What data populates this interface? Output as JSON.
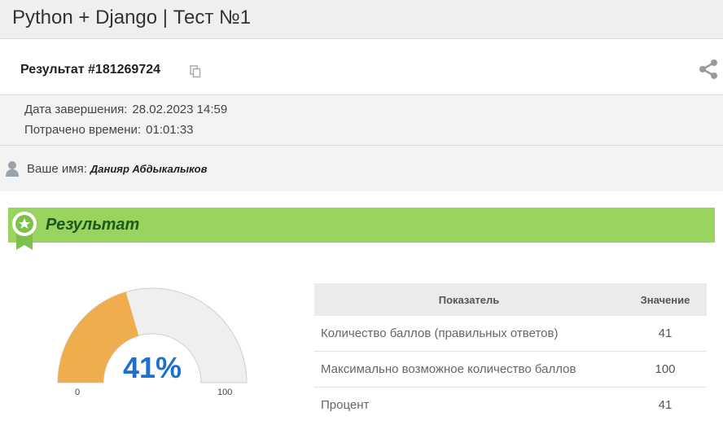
{
  "header": {
    "title": "Python + Django | Тест №1"
  },
  "result": {
    "title": "Результат #181269724",
    "copy_icon": "copy-icon",
    "share_icon": "share-icon"
  },
  "meta": {
    "finished_label": "Дата завершения:",
    "finished_value": "28.02.2023 14:59",
    "spent_label": "Потрачено времени:",
    "spent_value": "01:01:33"
  },
  "user": {
    "icon": "user-icon",
    "label": "Ваше имя:",
    "name": "Данияр Абдыкалыков"
  },
  "banner": {
    "label": "Результат",
    "icon": "award-ribbon-icon"
  },
  "gauge": {
    "value_text": "41%",
    "value": 41,
    "min_label": "0",
    "max_label": "100",
    "fill_color": "#f0ad4e",
    "track_color": "#efefef"
  },
  "table": {
    "headers": [
      "Показатель",
      "Значение"
    ],
    "rows": [
      [
        "Количество баллов (правильных ответов)",
        "41"
      ],
      [
        "Максимально возможное количество баллов",
        "100"
      ],
      [
        "Процент",
        "41"
      ]
    ]
  },
  "colors": {
    "banner_bg": "#99d45f",
    "banner_text": "#1c5a1c",
    "percent_text": "#1f6fd0"
  }
}
